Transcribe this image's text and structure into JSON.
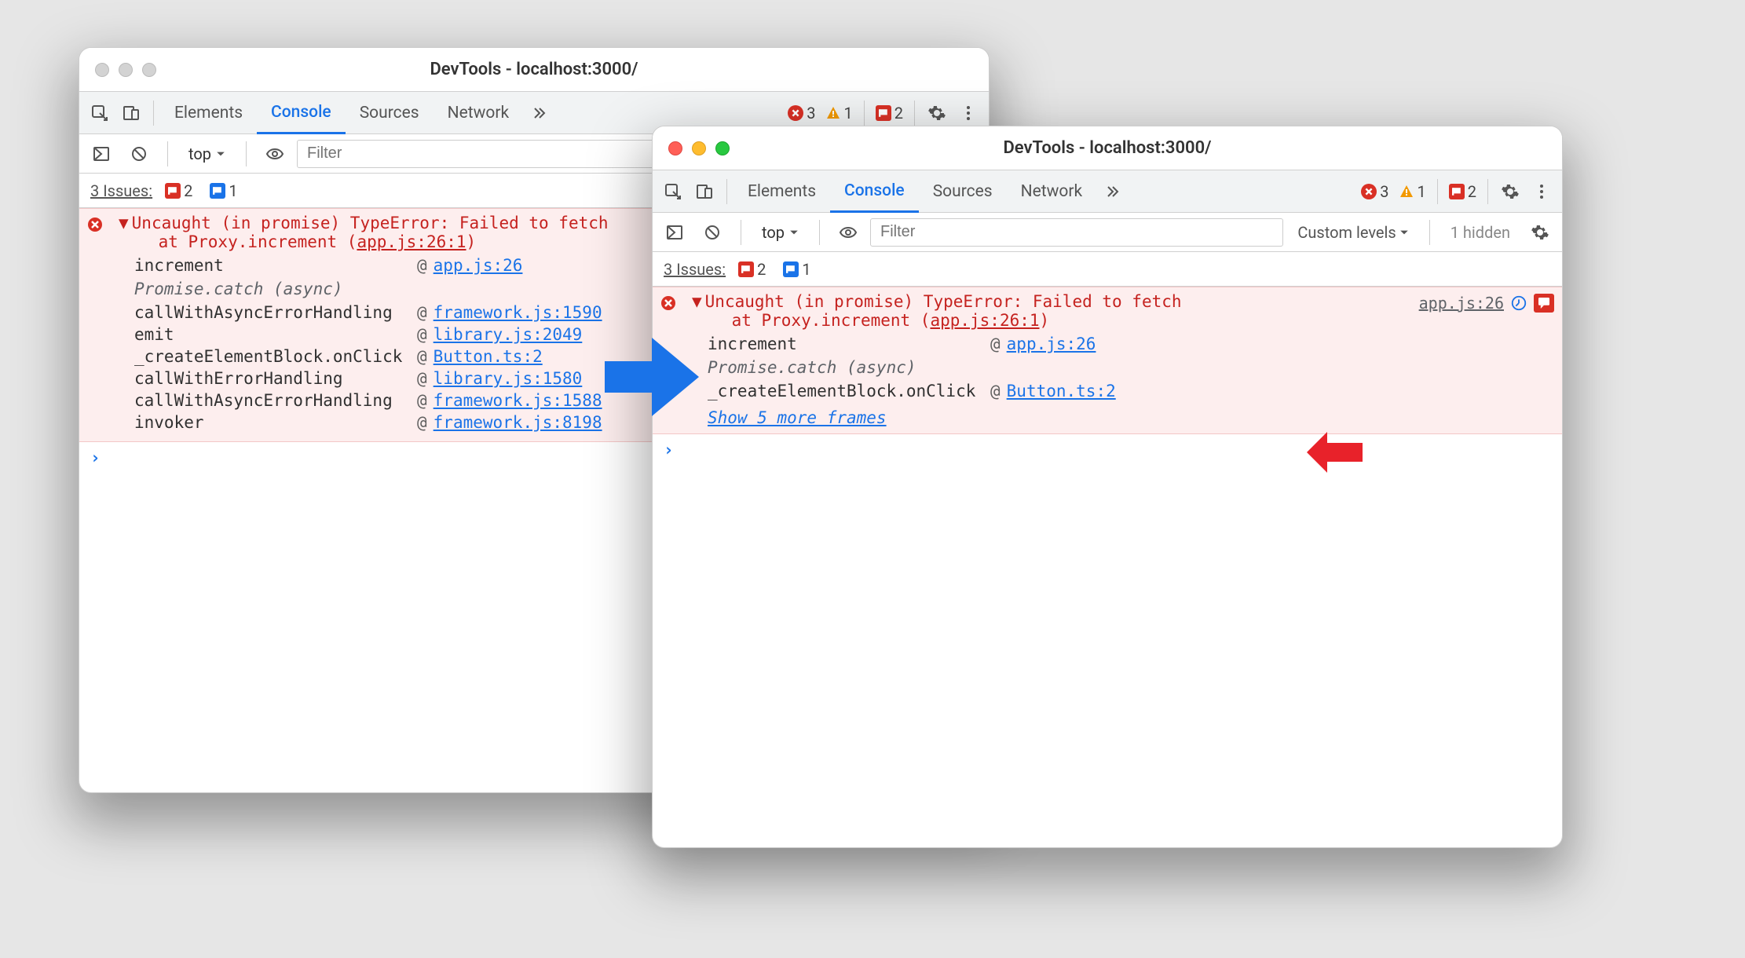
{
  "title": "DevTools - localhost:3000/",
  "tabs": {
    "elements": "Elements",
    "console": "Console",
    "sources": "Sources",
    "network": "Network"
  },
  "badges": {
    "errors": "3",
    "warnings": "1",
    "flags": "2"
  },
  "toolbar": {
    "top_label": "top",
    "filter_placeholder": "Filter",
    "custom_levels": "Custom levels",
    "hidden": "1 hidden"
  },
  "issues": {
    "label": "3 Issues:",
    "red": "2",
    "blue": "1"
  },
  "error": {
    "msg_l1": "Uncaught (in promise) TypeError: Failed to fetch",
    "msg_l2_prefix": "at Proxy.increment (",
    "msg_l2_loc": "app.js:26:1",
    "msg_l2_suffix": ")",
    "source_link": "app.js:26"
  },
  "stack_left": [
    {
      "fn": "increment",
      "link": "app.js:26"
    },
    {
      "async": "Promise.catch (async)"
    },
    {
      "fn": "callWithAsyncErrorHandling",
      "link": "framework.js:1590"
    },
    {
      "fn": "emit",
      "link": "library.js:2049"
    },
    {
      "fn": "_createElementBlock.onClick",
      "link": "Button.ts:2"
    },
    {
      "fn": "callWithErrorHandling",
      "link": "library.js:1580"
    },
    {
      "fn": "callWithAsyncErrorHandling",
      "link": "framework.js:1588"
    },
    {
      "fn": "invoker",
      "link": "framework.js:8198"
    }
  ],
  "stack_right": [
    {
      "fn": "increment",
      "link": "app.js:26"
    },
    {
      "async": "Promise.catch (async)"
    },
    {
      "fn": "_createElementBlock.onClick",
      "link": "Button.ts:2"
    }
  ],
  "show_more": "Show 5 more frames"
}
